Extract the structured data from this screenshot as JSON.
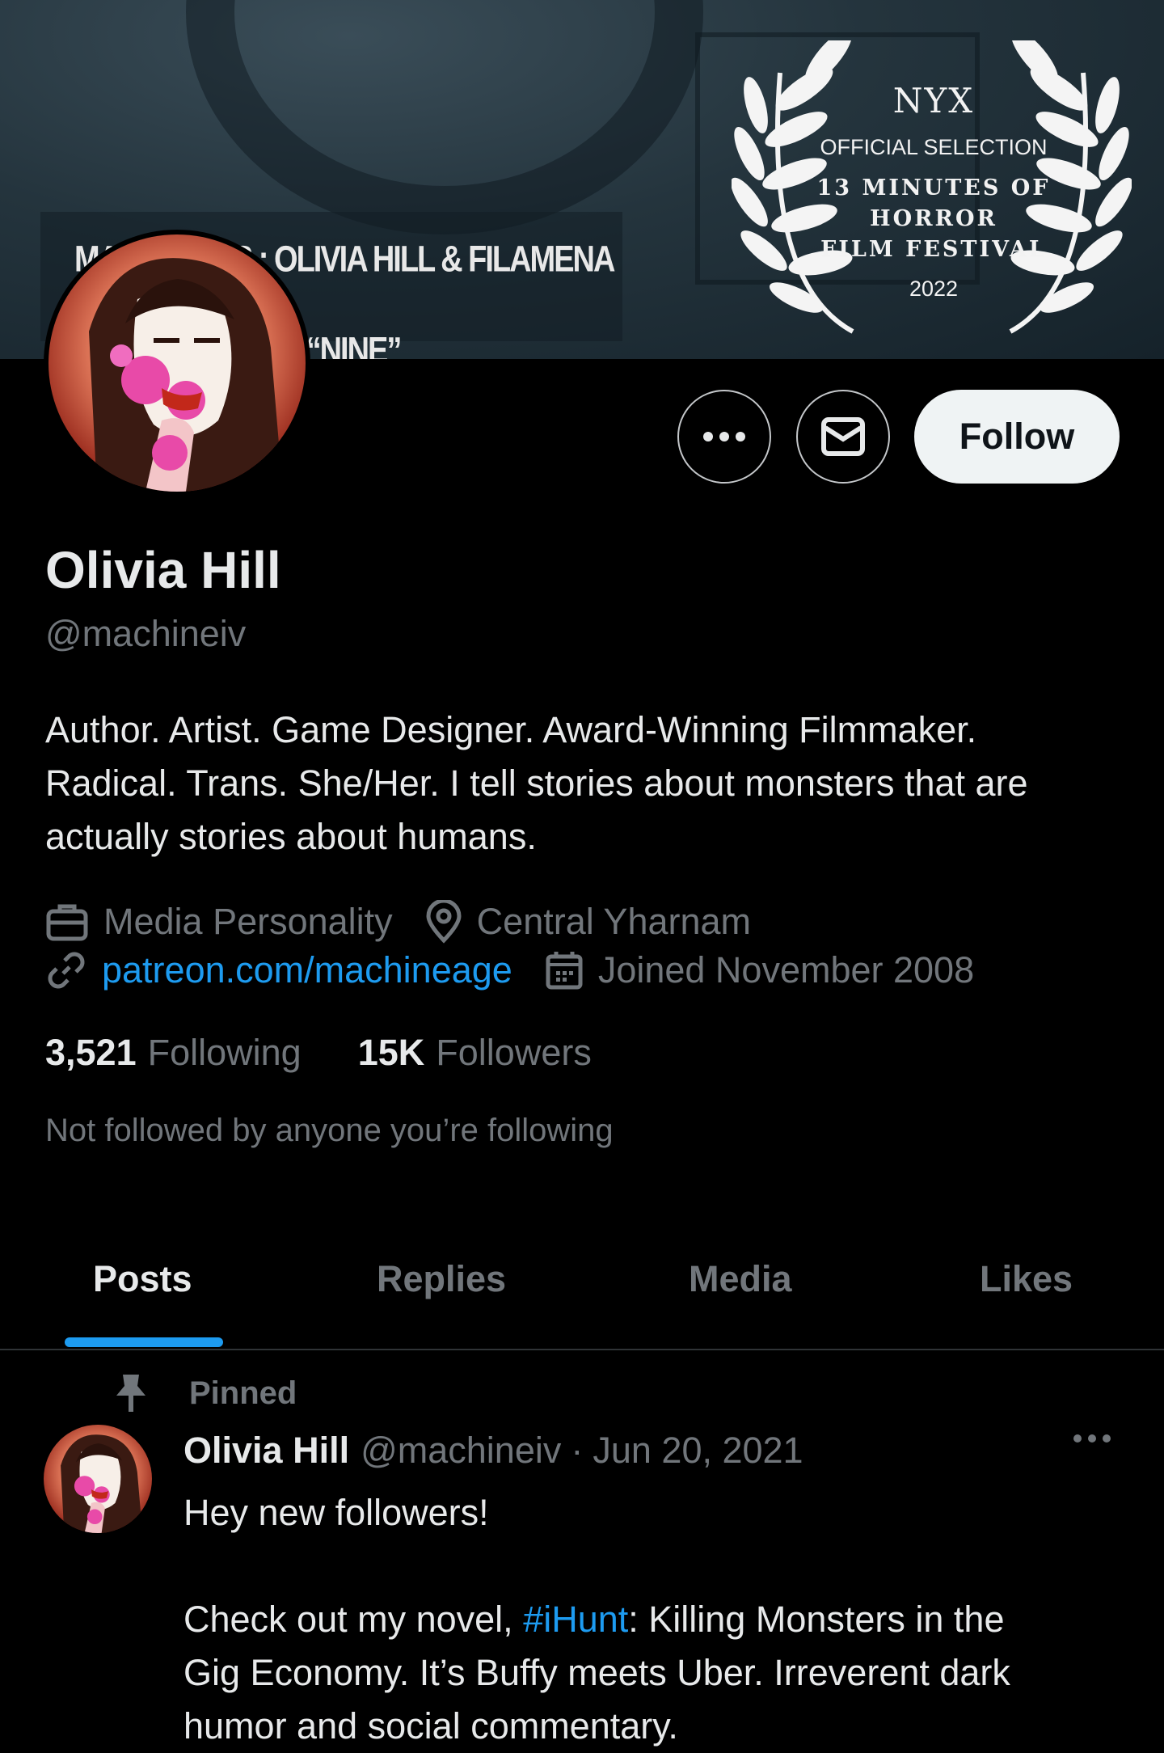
{
  "banner": {
    "credit_line1": "MA  UCTIONS : OLIVIA HILL & FILAMENA YOUNG",
    "credit_line2": "“NINE”",
    "laurel": {
      "org": "NYX",
      "selection": "OFFICIAL SELECTION",
      "festival_line1": "13 MINUTES OF HORROR",
      "festival_line2": "FILM FESTIVAL",
      "year": "2022"
    }
  },
  "actions": {
    "more_icon": "more-horizontal-icon",
    "message_icon": "envelope-icon",
    "follow_label": "Follow"
  },
  "profile": {
    "name": "Olivia Hill",
    "handle": "@machineiv",
    "bio_line1": "Author. Artist. Game Designer. Award-Winning Filmmaker.",
    "bio_line2": "Radical. Trans. She/Her. I tell stories about monsters that are",
    "bio_line3": "actually stories about humans.",
    "category": "Media Personality",
    "location": "Central Yharnam",
    "website": "patreon.com/machineage",
    "joined": "Joined November 2008"
  },
  "stats": {
    "following_count": "3,521",
    "following_label": "Following",
    "followers_count": "15K",
    "followers_label": "Followers",
    "not_followed": "Not followed by anyone you’re following"
  },
  "tabs": [
    {
      "label": "Posts",
      "active": true
    },
    {
      "label": "Replies",
      "active": false
    },
    {
      "label": "Media",
      "active": false
    },
    {
      "label": "Likes",
      "active": false
    }
  ],
  "post": {
    "pinned_label": "Pinned",
    "author_name": "Olivia Hill",
    "author_handle": "@machineiv",
    "separator": "·",
    "date": "Jun 20, 2021",
    "line1": "Hey new followers!",
    "line2_pre": "Check out my novel, ",
    "hashtag": "#iHunt",
    "line2_post": ": Killing Monsters in the",
    "line3": "Gig Economy. It’s Buffy meets Uber. Irreverent dark",
    "line4": "humor and social commentary."
  },
  "colors": {
    "background": "#000000",
    "accent": "#1d9bf0",
    "text_primary": "#e7e9ea",
    "text_secondary": "#71767b",
    "follow_bg": "#eff3f4"
  }
}
